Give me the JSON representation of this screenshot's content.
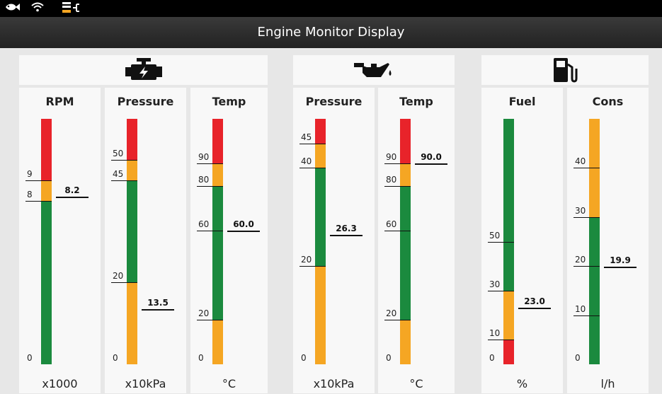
{
  "colors": {
    "green": "#1b8a3e",
    "yellow": "#f5a623",
    "red": "#e8232a"
  },
  "title": "Engine Monitor Display",
  "statusbar": {
    "icons": [
      "fish-icon",
      "wifi-icon",
      "engine-connection-icon"
    ]
  },
  "groups": [
    {
      "icon": "engine-icon"
    },
    {
      "icon": "oil-can-icon"
    },
    {
      "icon": "fuel-pump-icon"
    }
  ],
  "gauges": [
    {
      "title": "RPM",
      "unit": "x1000",
      "value": 8.2,
      "value_label": "8.2",
      "min": 0,
      "max": 12,
      "ticks": [
        0,
        8,
        9
      ],
      "ranges": [
        [
          0,
          8,
          "green"
        ],
        [
          8,
          9,
          "yellow"
        ],
        [
          9,
          12,
          "red"
        ]
      ]
    },
    {
      "title": "Pressure",
      "unit": "x10kPa",
      "value": 13.5,
      "value_label": "13.5",
      "min": 0,
      "max": 60,
      "ticks": [
        0,
        20,
        45,
        50
      ],
      "ranges": [
        [
          0,
          20,
          "yellow"
        ],
        [
          20,
          45,
          "green"
        ],
        [
          45,
          50,
          "yellow"
        ],
        [
          50,
          60,
          "red"
        ]
      ]
    },
    {
      "title": "Temp",
      "unit": "°C",
      "value": 60.0,
      "value_label": "60.0",
      "min": 0,
      "max": 110,
      "ticks": [
        0,
        20,
        60,
        80,
        90
      ],
      "ranges": [
        [
          0,
          20,
          "yellow"
        ],
        [
          20,
          80,
          "green"
        ],
        [
          80,
          90,
          "yellow"
        ],
        [
          90,
          110,
          "red"
        ]
      ]
    },
    {
      "title": "Pressure",
      "unit": "x10kPa",
      "value": 26.3,
      "value_label": "26.3",
      "min": 0,
      "max": 50,
      "ticks": [
        0,
        20,
        40,
        45
      ],
      "ranges": [
        [
          0,
          20,
          "yellow"
        ],
        [
          20,
          40,
          "green"
        ],
        [
          40,
          45,
          "yellow"
        ],
        [
          45,
          50,
          "red"
        ]
      ]
    },
    {
      "title": "Temp",
      "unit": "°C",
      "value": 90.0,
      "value_label": "90.0",
      "min": 0,
      "max": 110,
      "ticks": [
        0,
        20,
        60,
        80,
        90
      ],
      "ranges": [
        [
          0,
          20,
          "yellow"
        ],
        [
          20,
          80,
          "green"
        ],
        [
          80,
          90,
          "yellow"
        ],
        [
          90,
          110,
          "red"
        ]
      ]
    },
    {
      "title": "Fuel",
      "unit": "%",
      "value": 23.0,
      "value_label": "23.0",
      "min": 0,
      "max": 100,
      "ticks": [
        0,
        10,
        30,
        50
      ],
      "ranges": [
        [
          0,
          10,
          "red"
        ],
        [
          10,
          30,
          "yellow"
        ],
        [
          30,
          100,
          "green"
        ]
      ]
    },
    {
      "title": "Cons",
      "unit": "l/h",
      "value": 19.9,
      "value_label": "19.9",
      "min": 0,
      "max": 50,
      "ticks": [
        0,
        10,
        20,
        30,
        40
      ],
      "ranges": [
        [
          0,
          30,
          "green"
        ],
        [
          30,
          50,
          "yellow"
        ]
      ]
    }
  ]
}
